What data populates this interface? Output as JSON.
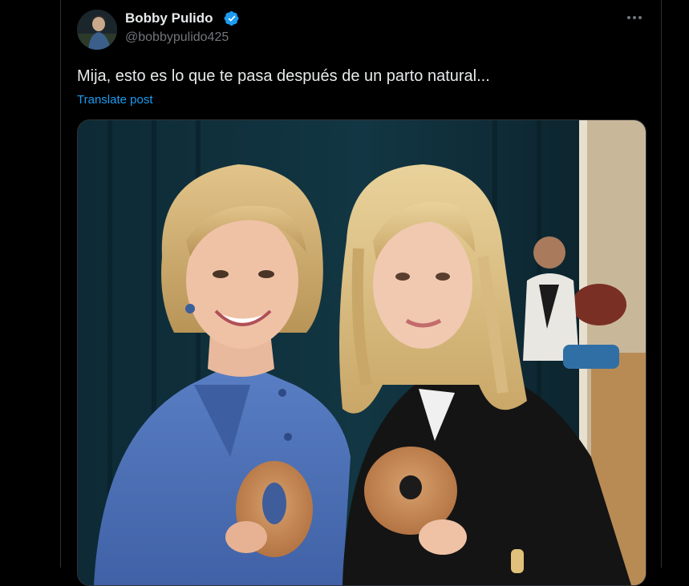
{
  "post": {
    "author": {
      "display_name": "Bobby Pulido",
      "handle": "@bobbypulido425",
      "verified": true,
      "avatar_icon": "avatar-photo"
    },
    "text": "Mija, esto es lo que te pasa después de un parto natural...",
    "translate_label": "Translate post",
    "more_icon": "more-horizontal-icon",
    "media": {
      "type": "photo"
    }
  },
  "colors": {
    "background": "#000000",
    "text_primary": "#e7e9ea",
    "text_secondary": "#71767b",
    "link": "#1d9bf0",
    "border": "#2f3336",
    "verified": "#1d9bf0"
  }
}
